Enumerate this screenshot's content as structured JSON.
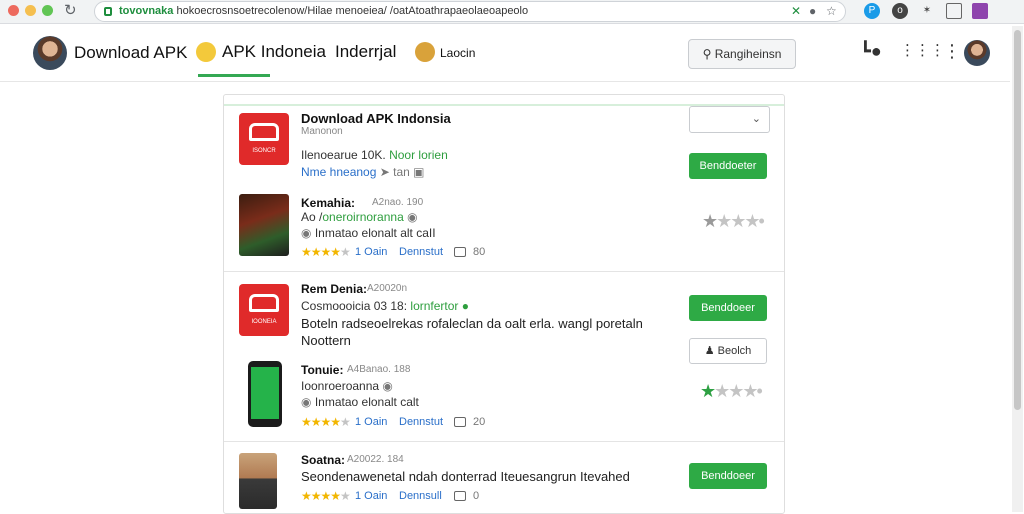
{
  "browser": {
    "url_domain": "tovovnaka",
    "url_path": " hokoecrosnsoetrecolenow/Hilae menoeiea/ /oatAtoathrapaeolaeoapeolo",
    "icons": [
      "reload-icon",
      "lock-icon",
      "close-icon",
      "location-icon",
      "star-icon",
      "extension-icon"
    ]
  },
  "header": {
    "brand": "Download APK",
    "tabs": [
      {
        "label": "APK Indoneia",
        "active": true
      },
      {
        "label": "Inderrjal",
        "active": false
      },
      {
        "label": "Laocin",
        "active": false
      }
    ],
    "search_label": "Rangiheinsn",
    "accent": "#34a853"
  },
  "card": {
    "title": "Download APK Indonsia",
    "subtitle": "Manonon",
    "items": [
      {
        "icon_text": "ISONCR",
        "line1_prefix": "Ilenoearue 10K.",
        "line1_green": "Noor lorien",
        "line2": "Nme hneanog",
        "line2_meta": "tan",
        "button": "Benddoeter"
      },
      {
        "name": "Kemahia:",
        "name_meta": "A2nao. 190",
        "line1_prefix": "Ao /",
        "line1_rest": "oneroirnoranna",
        "line2": "Inmatao elonalt alt caII",
        "stars_on": 4,
        "rating_text": "1 Oain",
        "link": "Dennstut",
        "count": "80",
        "rating": 1
      },
      {
        "icon_text": "IOONEIA",
        "name": "Rem Denia:",
        "name_meta": "A20020n",
        "line1_prefix": "Cosmoooicia 03 18:",
        "line1_green": "lornfertor",
        "desc1": "Boteln radseoelrekas rofaleclan da oalt erla. wangl poretaln",
        "desc2": "Noottern",
        "button": "Benddoeer",
        "button2": "Beolch"
      },
      {
        "name": "Tonuie:",
        "name_meta": "A4Banao. 188",
        "line1": "Ioonroeroanna",
        "line2": "Inmatao elonalt calt",
        "stars_on": 4,
        "rating_text": "1 Oain",
        "link": "Dennstut",
        "count": "20",
        "rating": 1
      },
      {
        "name": "Soatna:",
        "name_meta": "A20022. 184",
        "desc1": "Seondenawenetal ndah donterrad Iteuesangrun Itevahed",
        "stars_on": 4,
        "rating_text": "1 Oain",
        "link": "Dennsull",
        "count": "0",
        "button": "Benddoeer"
      }
    ]
  },
  "colors": {
    "download_button": "#2eaa45",
    "app_icon_red": "#e02a2a",
    "star_yellow": "#f2b600",
    "link_blue": "#2a6fc9"
  }
}
